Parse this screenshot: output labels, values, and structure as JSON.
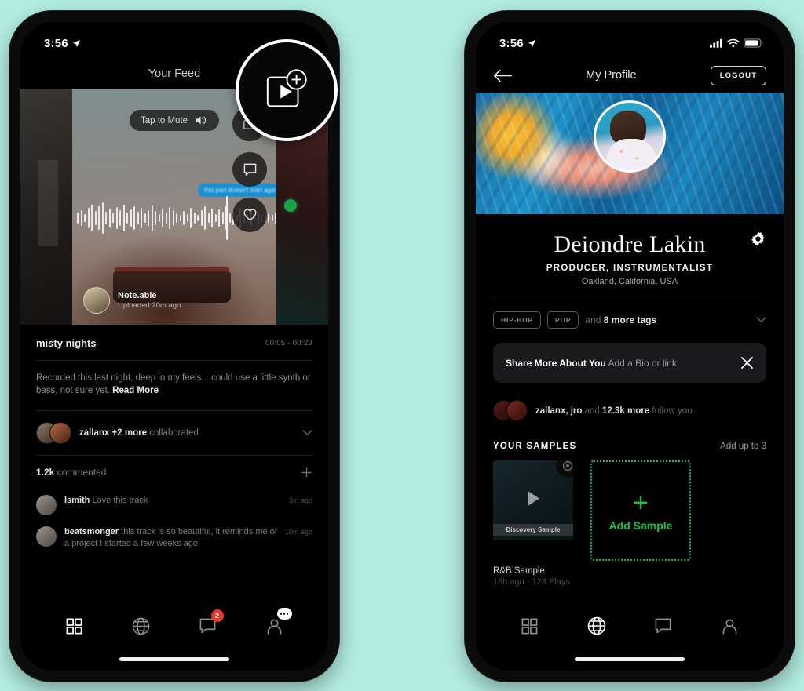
{
  "background_color": "#b3ece0",
  "accent_green": "#19c24a",
  "badge_red": "#e8392c",
  "left_phone": {
    "status": {
      "time": "3:56",
      "location_icon": "location-arrow-icon"
    },
    "header": {
      "title": "Your Feed"
    },
    "magnifier": {
      "icon": "add-video-icon"
    },
    "player": {
      "mute_label": "Tap to Mute",
      "mute_icon": "speaker-wave-icon",
      "waveform_tooltip": "this part doesn't start again",
      "actions": [
        {
          "name": "share-button",
          "icon": "share-icon"
        },
        {
          "name": "comment-button",
          "icon": "comment-bubble-icon"
        },
        {
          "name": "like-button",
          "icon": "heart-icon"
        }
      ],
      "poster": {
        "name": "Note.able",
        "subtitle": "Uploaded 20m ago"
      }
    },
    "track": {
      "title": "misty nights",
      "timestamp": "00:05 - 00:29",
      "description": "Recorded this last night, deep in my feels... could use a little synth or bass, not sure yet.",
      "read_more": "Read More"
    },
    "collaborators": {
      "names": "zallanx +2 more",
      "suffix": "collaborated",
      "chevron": "chevron-down-icon"
    },
    "comments": {
      "count": "1.2k",
      "count_label": "commented",
      "add_icon": "plus-icon",
      "items": [
        {
          "user": "lsmith",
          "text": "Love this track",
          "time": "3m ago"
        },
        {
          "user": "beatsmonger",
          "text": "this track is so beautiful, it reminds me of a project I started a few weeks ago",
          "time": "10m ago"
        }
      ]
    },
    "tabbar": [
      {
        "name": "tab-grid",
        "icon": "grid-icon",
        "active": true,
        "badge": null
      },
      {
        "name": "tab-discover",
        "icon": "globe-icon",
        "active": false,
        "badge": null
      },
      {
        "name": "tab-messages",
        "icon": "chat-bubble-icon",
        "active": false,
        "badge": "2"
      },
      {
        "name": "tab-profile",
        "icon": "person-icon",
        "active": false,
        "badge": null
      }
    ]
  },
  "right_phone": {
    "status": {
      "time": "3:56",
      "location_icon": "location-arrow-icon",
      "cellular_icon": "cellular-bars-icon",
      "wifi_icon": "wifi-icon",
      "battery_icon": "battery-icon"
    },
    "nav": {
      "back_icon": "back-arrow-icon",
      "title": "My Profile",
      "logout_label": "LOGOUT"
    },
    "profile": {
      "name": "Deiondre Lakin",
      "role": "PRODUCER, INSTRUMENTALIST",
      "location": "Oakland, California, USA",
      "settings_icon": "gear-icon",
      "avatar": "profile-photo"
    },
    "tags": {
      "chips": [
        "HIP-HOP",
        "POP"
      ],
      "more_prefix": "and",
      "more_count": "8 more tags",
      "chevron": "chevron-down-icon"
    },
    "bio_banner": {
      "title": "Share More About You",
      "subtitle": "Add a Bio or link",
      "close_icon": "close-icon"
    },
    "followers": {
      "names": "zallanx, jro",
      "connector": "and",
      "count": "12.3k more",
      "suffix": "follow you"
    },
    "samples": {
      "title": "YOUR SAMPLES",
      "hint": "Add up to 3",
      "items": [
        {
          "caption": "Discovery Sample",
          "name": "R&B Sample",
          "stats": "18h ago · 123 Plays",
          "play_icon": "play-icon",
          "badge_icon": "record-icon"
        }
      ],
      "add": {
        "plus": "+",
        "label": "Add Sample"
      }
    },
    "tabbar": [
      {
        "name": "tab-grid",
        "icon": "grid-icon",
        "active": false,
        "badge": null
      },
      {
        "name": "tab-discover",
        "icon": "globe-icon",
        "active": true,
        "badge": null
      },
      {
        "name": "tab-messages",
        "icon": "chat-bubble-icon",
        "active": false,
        "badge": null
      },
      {
        "name": "tab-profile",
        "icon": "person-icon",
        "active": false,
        "badge": null
      }
    ]
  }
}
